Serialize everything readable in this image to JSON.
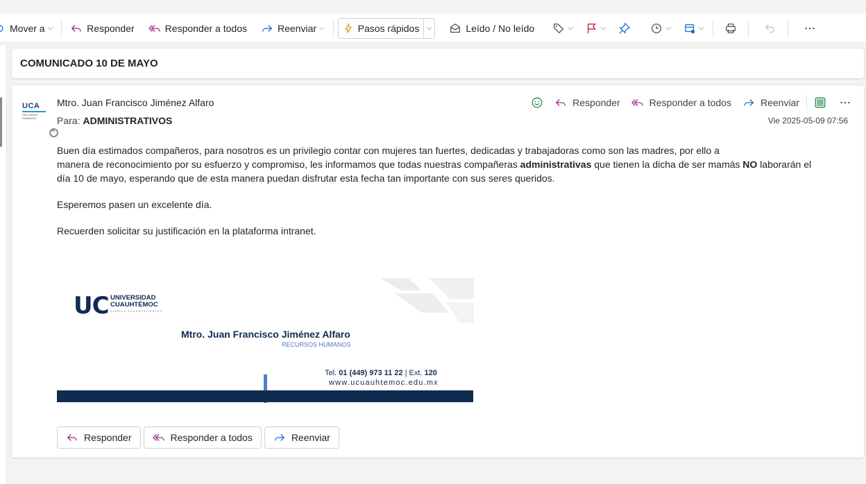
{
  "colors": {
    "accent_purple": "#9c2a8c",
    "accent_blue": "#1b6bd7",
    "brand_navy": "#0f2b50",
    "green": "#107c41"
  },
  "toolbar": {
    "move": "Mover a",
    "reply": "Responder",
    "reply_all": "Responder a todos",
    "forward": "Reenviar",
    "quick_steps": "Pasos rápidos",
    "read_unread": "Leído / No leído",
    "icons": [
      "folder-move-icon",
      "reply-icon",
      "reply-all-icon",
      "forward-icon",
      "lightning-icon",
      "envelope-open-icon",
      "tag-icon",
      "flag-icon",
      "pin-icon",
      "clock-icon",
      "rules-icon",
      "print-icon",
      "undo-icon",
      "more-icon"
    ]
  },
  "subject": "COMUNICADO 10 DE MAYO",
  "message": {
    "avatar_text": "UCA",
    "avatar_sub": "RECURSOS HUMANOS",
    "sender": "Mtro. Juan Francisco Jiménez Alfaro",
    "to_label": "Para:",
    "to": "ADMINISTRATIVOS",
    "date": "Vie 2025-05-09 07:56",
    "actions": {
      "reply": "Responder",
      "reply_all": "Responder a todos",
      "forward": "Reenviar"
    },
    "body": {
      "p1_a": "Buen día estimados compañeros, para nosotros es un privilegio contar con mujeres tan fuertes, dedicadas y trabajadoras como son las madres, por ello a",
      "p1_b": "manera de reconocimiento por su esfuerzo y compromiso, les informamos que todas nuestras compañeras ",
      "p1_bold1": "administrativas",
      "p1_c": " que tienen la dicha de ser mamás ",
      "p1_bold2": "NO",
      "p1_d": " laborarán el",
      "p1_e": "día 10 de mayo, esperando que de esta manera puedan disfrutar esta fecha tan importante con sus seres queridos.",
      "p2": "Esperemos pasen un excelente día.",
      "p3": "Recuerden solicitar su justificación en la plataforma intranet."
    },
    "signature": {
      "uc": "UC",
      "university_line1": "UNIVERSIDAD",
      "university_line2": "CUAUHTÉMOC",
      "campus": "CAMPUS AGUASCALIENTES",
      "name": "Mtro. Juan Francisco Jiménez Alfaro",
      "role": "RECURSOS HUMANOS",
      "tel_label": "Tel. ",
      "tel": "01 (449) 973 11 22",
      "ext_label": " | Ext. ",
      "ext": "120",
      "web": "www.ucuauhtemoc.edu.mx"
    },
    "reply_buttons": {
      "reply": "Responder",
      "reply_all": "Responder a todos",
      "forward": "Reenviar"
    }
  }
}
